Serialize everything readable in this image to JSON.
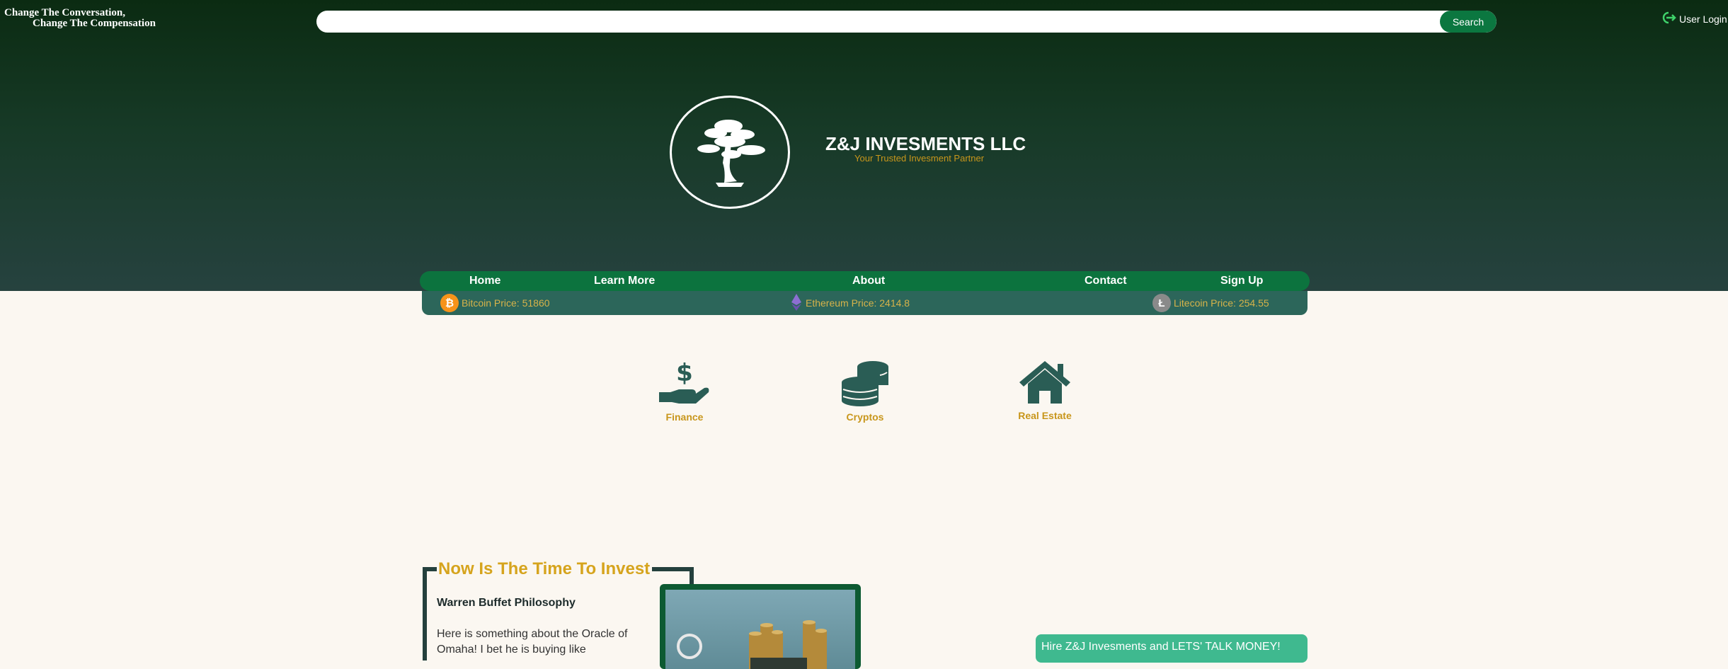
{
  "header": {
    "slogan_line1": "Change The Conversation,",
    "slogan_line2": "Change The Compensation",
    "search": {
      "placeholder": "",
      "button_label": "Search"
    },
    "user_login_label": "User Login"
  },
  "brand": {
    "title": "Z&J INVESMENTS LLC",
    "subtitle": "Your Trusted Invesment Partner"
  },
  "nav": {
    "items": [
      {
        "label": "Home"
      },
      {
        "label": "Learn More"
      },
      {
        "label": "About"
      },
      {
        "label": "Contact"
      },
      {
        "label": "Sign Up"
      }
    ]
  },
  "ticker": {
    "bitcoin": {
      "label": "Bitcoin Price: 51860",
      "icon": "bitcoin-icon",
      "color": "#f7931a"
    },
    "ethereum": {
      "label": "Ethereum Price: 2414.8",
      "icon": "ethereum-icon",
      "color": "#8c6fd1"
    },
    "litecoin": {
      "label": "Litecoin Price: 254.55",
      "icon": "litecoin-icon",
      "color": "#8a8a8a"
    }
  },
  "services": [
    {
      "label": "Finance",
      "icon": "hand-dollar-icon"
    },
    {
      "label": "Cryptos",
      "icon": "coins-icon"
    },
    {
      "label": "Real Estate",
      "icon": "house-icon"
    }
  ],
  "main": {
    "section_title": "Now Is The Time To Invest",
    "subheading": "Warren Buffet Philosophy",
    "body": "Here is something about the Oracle of Omaha! I bet he is buying like",
    "cta_label": "Hire Z&J Invesments and LETS' TALK MONEY!"
  },
  "colors": {
    "accent_green": "#0c733e",
    "gold": "#c8961b",
    "teal_dark": "#2a5d55",
    "cta": "#3fb98f"
  }
}
